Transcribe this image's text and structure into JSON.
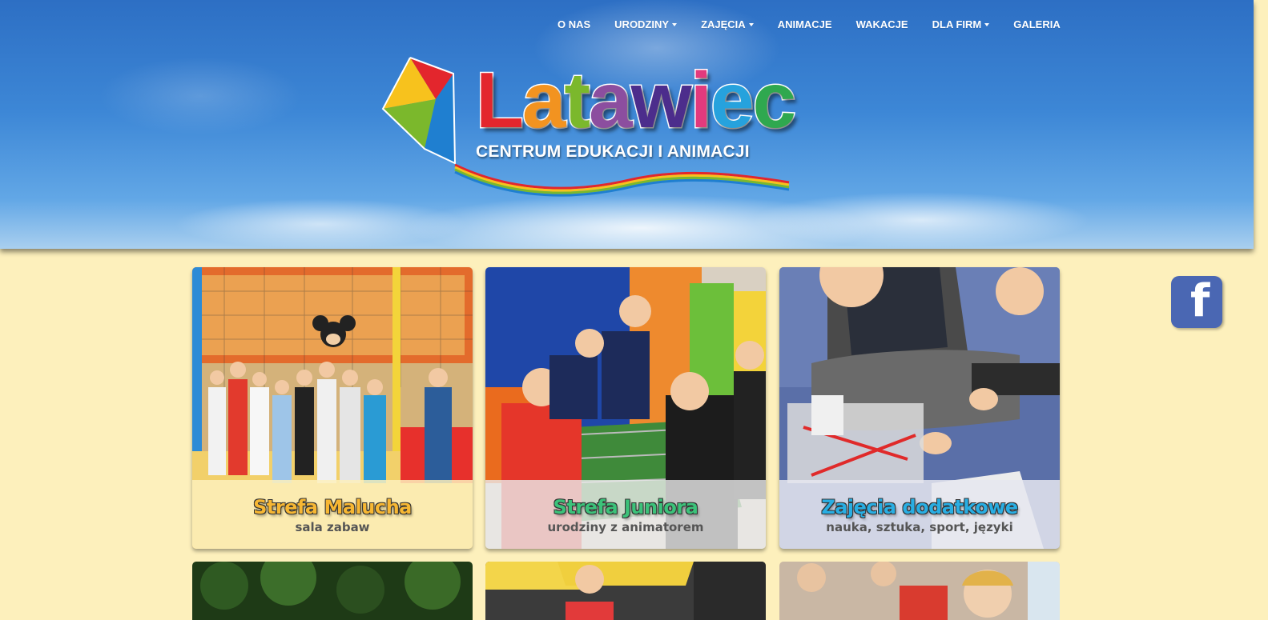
{
  "nav": {
    "items": [
      {
        "label": "O NAS",
        "dropdown": false
      },
      {
        "label": "URODZINY",
        "dropdown": true
      },
      {
        "label": "ZAJĘCIA",
        "dropdown": true
      },
      {
        "label": "ANIMACJE",
        "dropdown": false
      },
      {
        "label": "WAKACJE",
        "dropdown": false
      },
      {
        "label": "DLA FIRM",
        "dropdown": true
      },
      {
        "label": "GALERIA",
        "dropdown": false
      }
    ]
  },
  "logo": {
    "title_letters": [
      {
        "ch": "L",
        "color": "#e3262d"
      },
      {
        "ch": "a",
        "color": "#f29320"
      },
      {
        "ch": "t",
        "color": "#7bb82c"
      },
      {
        "ch": "a",
        "color": "#8c4e9f"
      },
      {
        "ch": "w",
        "color": "#4c2d8c"
      },
      {
        "ch": "i",
        "color": "#e23a7d"
      },
      {
        "ch": "e",
        "color": "#26a2dd"
      },
      {
        "ch": "c",
        "color": "#2fa84f"
      }
    ],
    "subtitle": "CENTRUM EDUKACJI I ANIMACJI"
  },
  "social": {
    "facebook_icon": "facebook-icon",
    "glyph": "f"
  },
  "cards": [
    {
      "title": "Strefa Malucha",
      "subtitle": "sala zabaw",
      "title_color": "#f7b733",
      "caption_bg": "rgba(253,240,188,0.85)"
    },
    {
      "title": "Strefa Juniora",
      "subtitle": "urodziny z animatorem",
      "title_color": "#3cc27a",
      "caption_bg": "rgba(235,235,235,0.8)"
    },
    {
      "title": "Zajęcia dodatkowe",
      "subtitle": "nauka, sztuka, sport, języki",
      "title_color": "#29aee3",
      "caption_bg": "rgba(230,232,240,0.85)"
    }
  ],
  "colors": {
    "page_bg": "#fdf0bc",
    "sky": "#3d87d6",
    "facebook": "#4a67b3"
  }
}
